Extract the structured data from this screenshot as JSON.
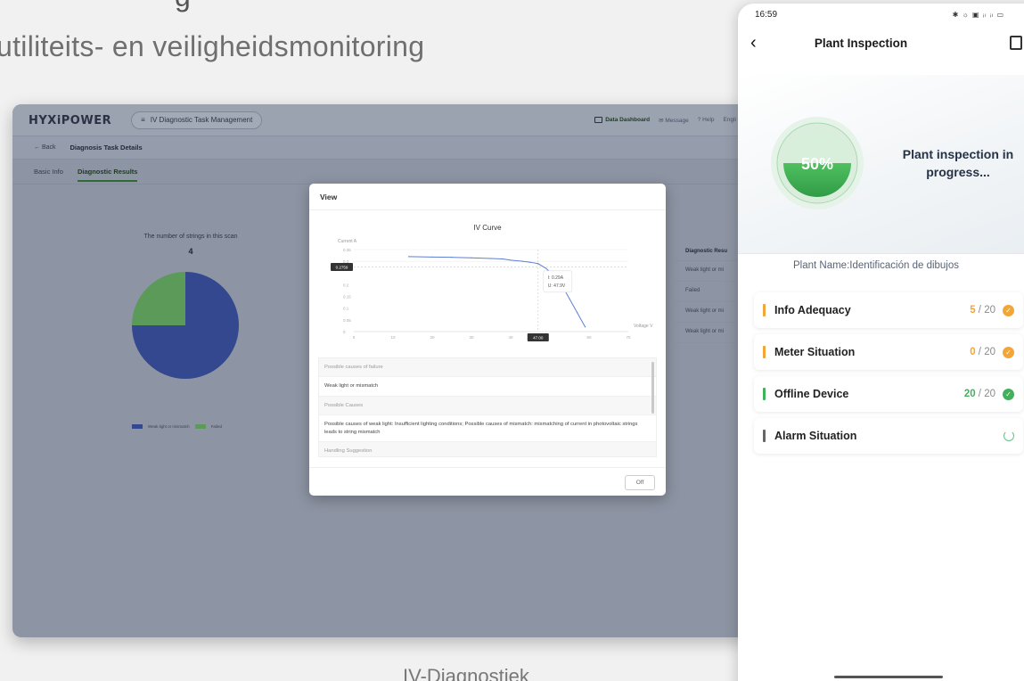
{
  "page": {
    "heading": "utiliteits- en veiligheidsmonitoring",
    "heading_top": "g",
    "caption": "IV-Diagnostiek"
  },
  "desktop": {
    "logo": "HYXiPOWER",
    "logo_sub": "",
    "module": "IV Diagnostic Task Management",
    "top_links": {
      "dashboard": "Data Dashboard",
      "message": "Message",
      "help": "Help",
      "lang": "Engli"
    },
    "back": "← Back",
    "page_title": "Diagnosis Task Details",
    "tabs": [
      "Basic Info",
      "Diagnostic Results"
    ],
    "strings_title": "The number of strings in this scan",
    "strings_count": "4",
    "legend": [
      "Weak light or mismatch",
      "Failed"
    ],
    "diag_header": "Diagnostic Resu",
    "diag_rows": [
      "Weak light or mi",
      "Failed",
      "Weak light or mi",
      "Weak light or mi"
    ],
    "pie": {
      "weak_light": 3,
      "failed": 1
    },
    "colors": {
      "weak": "#33488e",
      "failed": "#5b9a58"
    }
  },
  "modal": {
    "title": "View",
    "off": "Off",
    "causes": [
      {
        "kind": "label",
        "text": "Possible causes of failure"
      },
      {
        "kind": "value",
        "text": "Weak light or mismatch"
      },
      {
        "kind": "label",
        "text": "Possible Causes"
      },
      {
        "kind": "value",
        "text": "Possible causes of weak light: Insufficient lighting conditions; Possible causes of mismatch: mismatching of current in photovoltaic strings leads to string mismatch"
      },
      {
        "kind": "label",
        "text": "Handling Suggestion"
      }
    ]
  },
  "chart_data": {
    "type": "line",
    "title": "IV Curve",
    "xlabel": "Voltage V",
    "ylabel": "Current A",
    "xlim": [
      0,
      70
    ],
    "ylim": [
      0,
      0.35
    ],
    "x_ticks": [
      "0",
      "10",
      "20",
      "30",
      "40",
      "47.00",
      "60",
      "70"
    ],
    "y_ticks": [
      "0",
      "0.05",
      "0.1",
      "0.15",
      "0.2",
      "0.2759",
      "0.3",
      "0.35"
    ],
    "series": [
      {
        "name": "",
        "x": [
          14,
          20,
          25,
          30,
          35,
          38,
          40,
          43,
          45,
          47,
          49,
          51,
          53,
          55,
          57,
          59
        ],
        "y": [
          0.32,
          0.318,
          0.317,
          0.315,
          0.312,
          0.31,
          0.305,
          0.3,
          0.296,
          0.29,
          0.27,
          0.24,
          0.2,
          0.14,
          0.08,
          0.02
        ]
      }
    ],
    "crosshair": {
      "x_label": "47.00",
      "y_label": "0.2759"
    },
    "tooltip": [
      "I: 0.29A",
      "U: 47.9V"
    ],
    "grid": true
  },
  "phone": {
    "time": "16:59",
    "status_icons": "✱ ☼ ▣ ᵢₗ ᵢₗ ▭",
    "title": "Plant Inspection",
    "progress_pct": 50,
    "progress_label": "50%",
    "hero_text": "Plant inspection in progress...",
    "plant_name": "Plant Name:Identificación de dibujos",
    "items": [
      {
        "label": "Info Adequacy",
        "score": "5",
        "total": " / 20",
        "bar": "#f1a637",
        "score_color": "#f1a637",
        "status": "check",
        "status_color": "#f1a637"
      },
      {
        "label": "Meter Situation",
        "score": "0",
        "total": " / 20",
        "bar": "#f1a637",
        "score_color": "#f1a637",
        "status": "check",
        "status_color": "#f1a637"
      },
      {
        "label": "Offline Device",
        "score": "20",
        "total": " / 20",
        "bar": "#43b05c",
        "score_color": "#43b05c",
        "status": "check",
        "status_color": "#43b05c"
      },
      {
        "label": "Alarm Situation",
        "score": "",
        "total": "",
        "bar": "#666666",
        "score_color": "#888888",
        "status": "loading",
        "status_color": "#67c18a"
      }
    ]
  }
}
